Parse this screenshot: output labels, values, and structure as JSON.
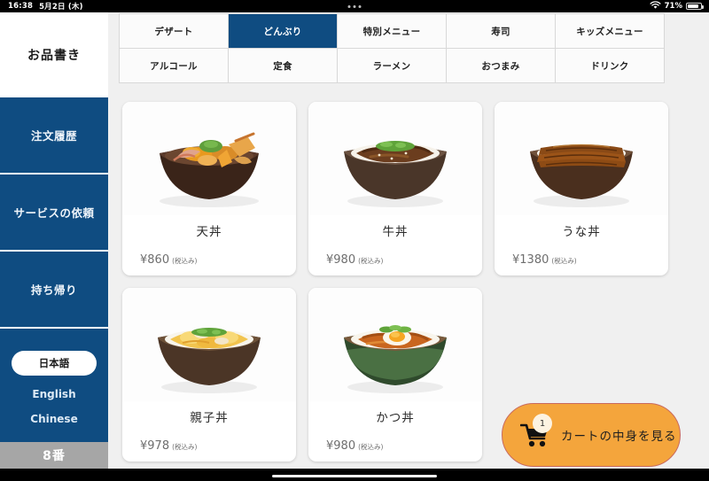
{
  "status_bar": {
    "time": "16:38",
    "date": "5月2日 (木)",
    "battery_percent": "71%",
    "wifi_icon": "wifi-icon",
    "battery_icon": "battery-icon",
    "multitask_dots": "multitask-dots-icon"
  },
  "sidebar": {
    "title": "お品書き",
    "buttons": [
      {
        "label": "注文履歴"
      },
      {
        "label": "サービスの依頼"
      },
      {
        "label": "持ち帰り"
      }
    ],
    "languages": [
      {
        "label": "日本語",
        "selected": true
      },
      {
        "label": "English",
        "selected": false
      },
      {
        "label": "Chinese",
        "selected": false
      }
    ],
    "table_number": "8番"
  },
  "tabs": [
    {
      "label": "デザート",
      "active": false
    },
    {
      "label": "どんぶり",
      "active": true
    },
    {
      "label": "特別メニュー",
      "active": false
    },
    {
      "label": "寿司",
      "active": false
    },
    {
      "label": "キッズメニュー",
      "active": false
    },
    {
      "label": "アルコール",
      "active": false
    },
    {
      "label": "定食",
      "active": false
    },
    {
      "label": "ラーメン",
      "active": false
    },
    {
      "label": "おつまみ",
      "active": false
    },
    {
      "label": "ドリンク",
      "active": false
    }
  ],
  "menu_items": [
    {
      "name": "天丼",
      "price": "¥860",
      "tax_note": "(税込み)",
      "image": "tempura-donburi-photo"
    },
    {
      "name": "牛丼",
      "price": "¥980",
      "tax_note": "(税込み)",
      "image": "gyudon-photo"
    },
    {
      "name": "うな丼",
      "price": "¥1380",
      "tax_note": "(税込み)",
      "image": "unadon-photo"
    },
    {
      "name": "親子丼",
      "price": "¥978",
      "tax_note": "(税込み)",
      "image": "oyakodon-photo"
    },
    {
      "name": "かつ丼",
      "price": "¥980",
      "tax_note": "(税込み)",
      "image": "katsudon-photo"
    }
  ],
  "cart": {
    "label": "カートの中身を見る",
    "count": "1",
    "icon": "shopping-cart-icon"
  },
  "colors": {
    "brand_blue": "#0f4c81",
    "cart_orange": "#f4a53c",
    "cart_border": "#c96a5e",
    "page_bg": "#f0f0f0",
    "table_gray": "#a6a6a6"
  }
}
